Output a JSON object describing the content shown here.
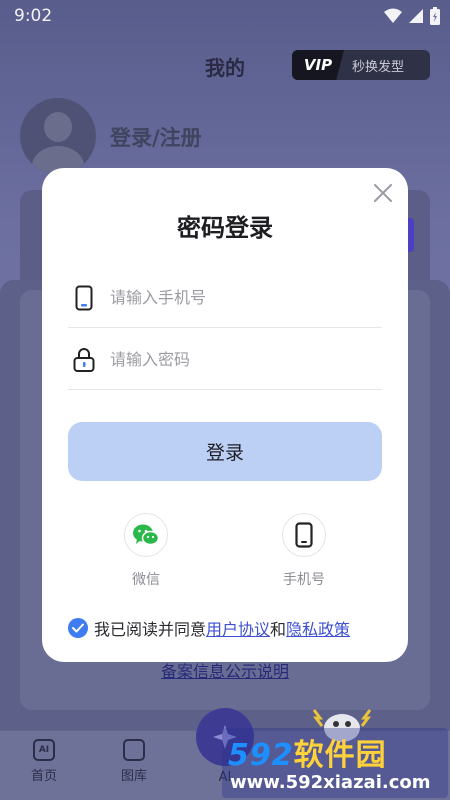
{
  "status_bar": {
    "time": "9:02"
  },
  "background": {
    "page_title": "我的",
    "vip_badge": "VIP",
    "vip_promo": "秒换发型",
    "login_register": "登录/注册",
    "record_link": "备案信息公示说明",
    "tabs": [
      {
        "label": "首页",
        "icon": "AI"
      },
      {
        "label": "图库",
        "icon": "gallery-icon"
      },
      {
        "label": "AI",
        "icon": "sparkle-icon"
      }
    ]
  },
  "dialog": {
    "title": "密码登录",
    "phone_placeholder": "请输入手机号",
    "password_placeholder": "请输入密码",
    "login_button": "登录",
    "alt_wechat": "微信",
    "alt_phone": "手机号",
    "agreement_prefix": "我已阅读并同意",
    "user_agreement": "用户协议",
    "and": "和",
    "privacy_policy": "隐私政策"
  },
  "watermark": {
    "brand_number": "592",
    "brand_text": "软件园",
    "url": "www.592xiazai.com"
  },
  "colors": {
    "accent": "#3f7cf2",
    "login_button": "#bcd0f5",
    "wechat_green": "#2bb84a",
    "link": "#3e4fd2"
  }
}
